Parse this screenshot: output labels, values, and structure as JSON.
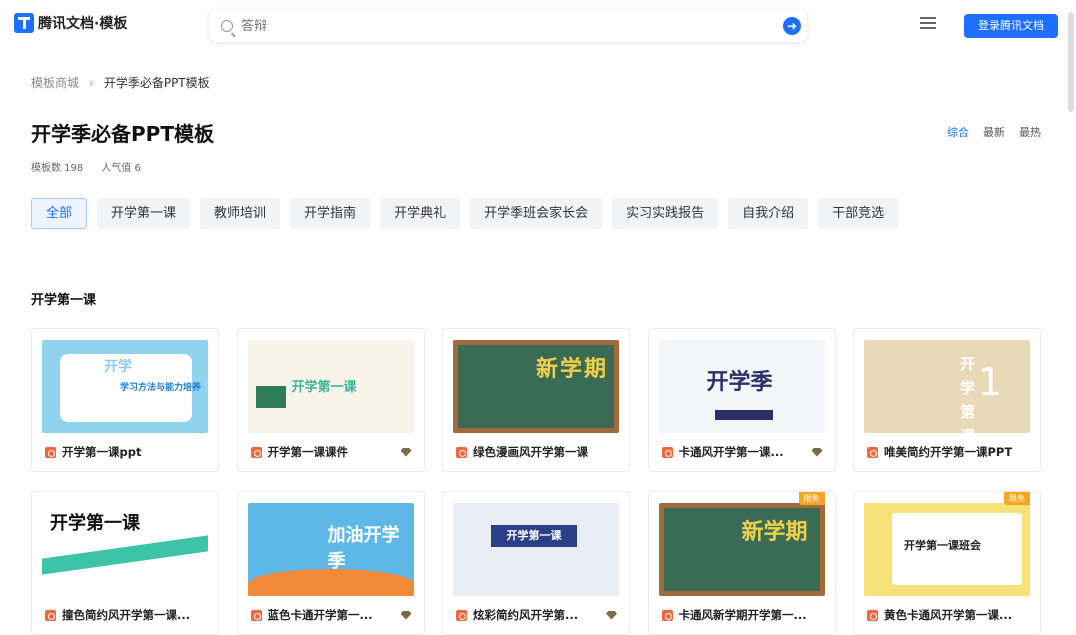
{
  "header": {
    "logo_text": "腾讯文档·模板",
    "search_placeholder": "答辩",
    "login_label": "登录腾讯文档"
  },
  "breadcrumb": {
    "root": "模板商城",
    "current": "开学季必备PPT模板"
  },
  "page": {
    "title": "开学季必备PPT模板",
    "template_count": "模板数 198",
    "popularity": "人气值 6",
    "sort": [
      "综合",
      "最新",
      "最热"
    ],
    "sort_active": "综合"
  },
  "chips": [
    "全部",
    "开学第一课",
    "教师培训",
    "开学指南",
    "开学典礼",
    "开学季班会家长会",
    "实习实践报告",
    "自我介绍",
    "干部竞选"
  ],
  "section": {
    "title": "开学第一课"
  },
  "cards": [
    {
      "title": "开学第一课ppt",
      "vip": false,
      "badge": "",
      "thumb_text": "学习方法与能力培养",
      "thumb_text2": "开学"
    },
    {
      "title": "开学第一课课件",
      "vip": true,
      "badge": "",
      "thumb_text": "开学第一课"
    },
    {
      "title": "绿色漫画风开学第一课",
      "vip": false,
      "badge": "",
      "thumb_text": "新学期"
    },
    {
      "title": "卡通风开学第一课...",
      "vip": true,
      "badge": "",
      "thumb_text": "开学季"
    },
    {
      "title": "唯美简约开学第一课PPT",
      "vip": false,
      "badge": "",
      "thumb_text": "开学第课",
      "thumb_num": "1"
    },
    {
      "title": "撞色简约风开学第一课...",
      "vip": false,
      "badge": "",
      "thumb_text": "开学第一课"
    },
    {
      "title": "蓝色卡通开学第一...",
      "vip": true,
      "badge": "",
      "thumb_text": "加油开学季"
    },
    {
      "title": "炫彩简约风开学第...",
      "vip": true,
      "badge": "",
      "thumb_text": "开学第一课"
    },
    {
      "title": "卡通风新学期开学第一...",
      "vip": false,
      "badge": "限免",
      "thumb_text": "新学期"
    },
    {
      "title": "黄色卡通风开学第一课...",
      "vip": false,
      "badge": "限免",
      "thumb_text": "开学第一课班会"
    }
  ]
}
